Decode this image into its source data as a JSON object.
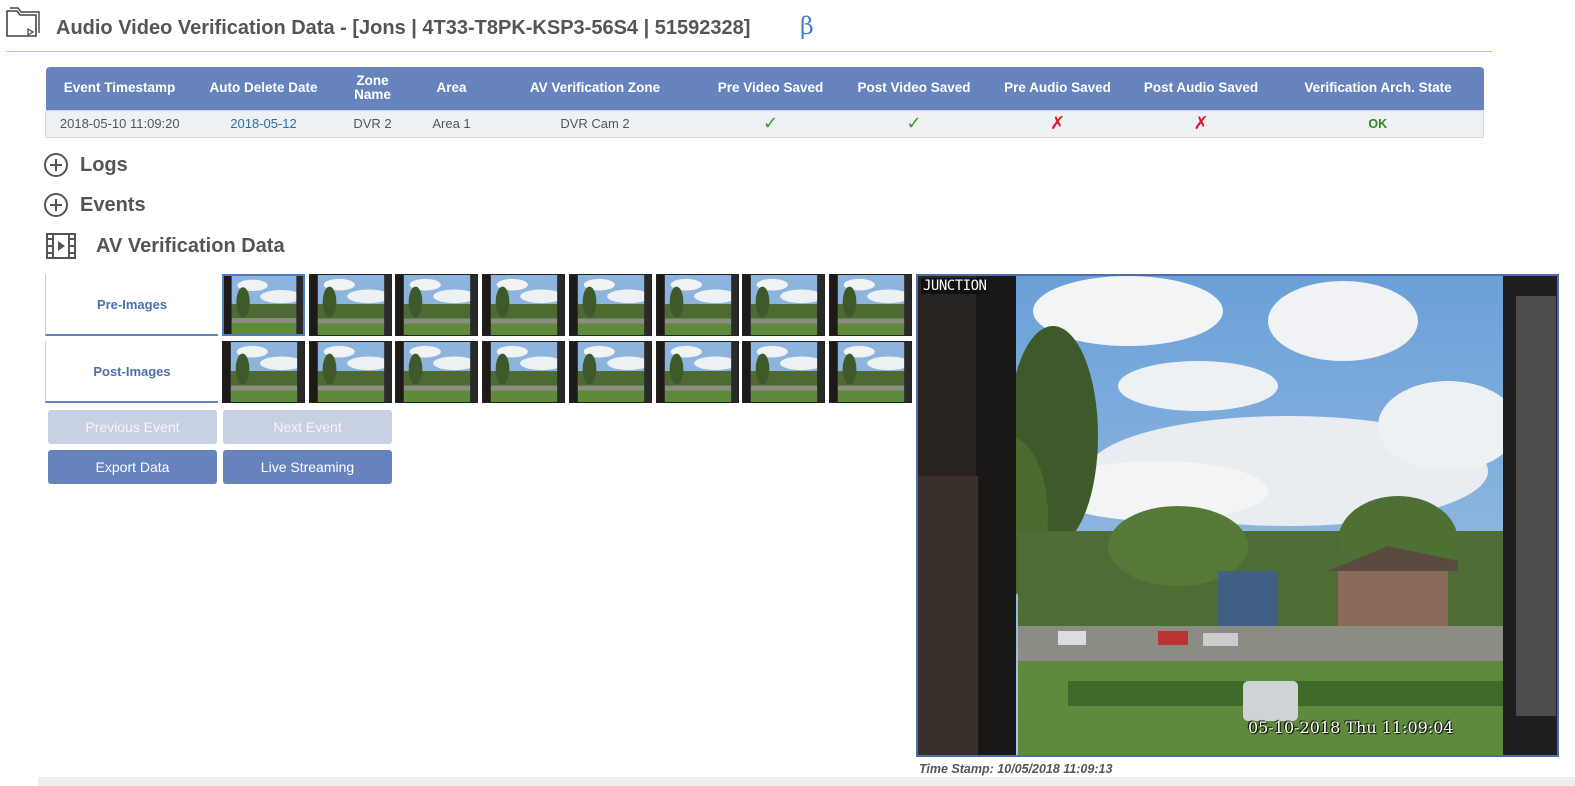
{
  "header": {
    "title": "Audio Video Verification Data - [Jons | 4T33-T8PK-KSP3-56S4 | 51592328]",
    "beta_symbol": "β"
  },
  "table": {
    "columns": [
      "Event Timestamp",
      "Auto Delete Date",
      "Zone Name",
      "Area",
      "AV Verification Zone",
      "Pre Video Saved",
      "Post Video Saved",
      "Pre Audio Saved",
      "Post Audio Saved",
      "Verification Arch. State"
    ],
    "row": {
      "event_timestamp": "2018-05-10 11:09:20",
      "auto_delete_date": "2018-05-12",
      "zone_name": "DVR 2",
      "area": "Area 1",
      "av_verification_zone": "DVR Cam 2",
      "pre_video_saved": "✓",
      "post_video_saved": "✓",
      "pre_audio_saved": "✗",
      "post_audio_saved": "✗",
      "verification_arch_state": "OK"
    }
  },
  "sections": {
    "logs": "Logs",
    "events": "Events",
    "av_data": "AV Verification Data"
  },
  "tabs": {
    "pre_images": "Pre-Images",
    "post_images": "Post-Images"
  },
  "buttons": {
    "previous_event": "Previous Event",
    "next_event": "Next Event",
    "export_data": "Export Data",
    "live_streaming": "Live Streaming"
  },
  "camera": {
    "overlay_label": "JUNCTION",
    "overlay_datetime": "05-10-2018 Thu 11:09:04",
    "time_stamp_caption": "Time Stamp: 10/05/2018 11:09:13"
  },
  "colors": {
    "accent": "#6783bd",
    "check": "#3a9a2a",
    "cross": "#e0182a",
    "link": "#2d6fa8",
    "header_rule": "#e6c84a"
  },
  "icons": {
    "folder": "folder-video-icon",
    "plus": "plus-circle-icon",
    "film": "film-icon",
    "check": "checkmark-icon",
    "cross": "cross-icon"
  }
}
